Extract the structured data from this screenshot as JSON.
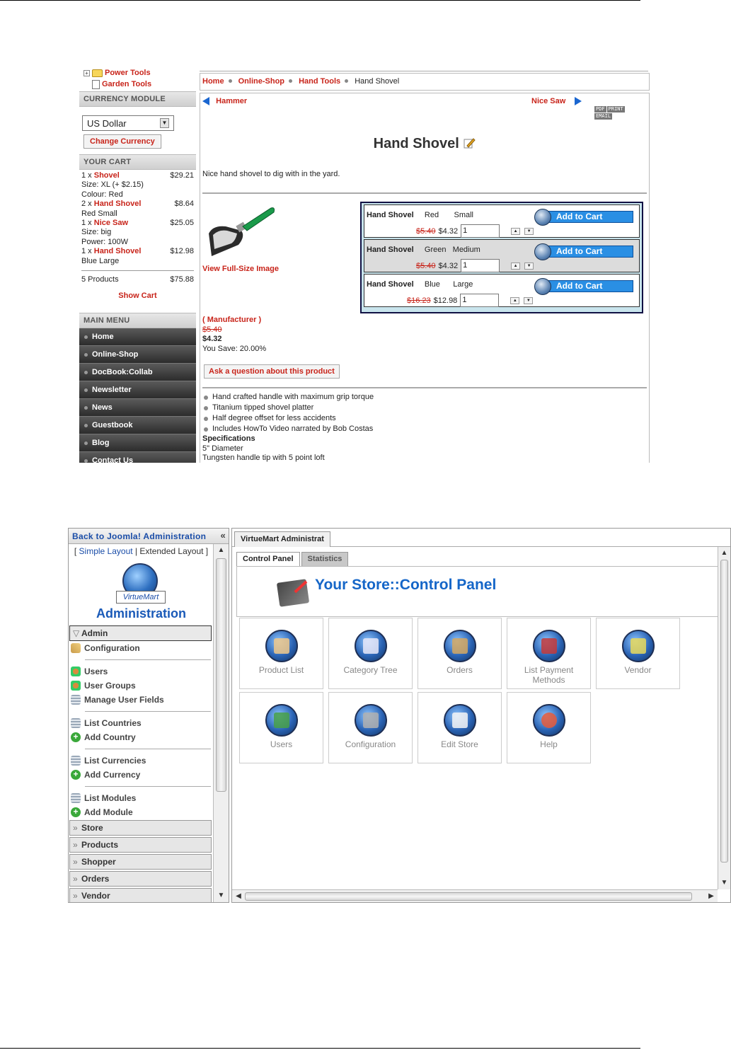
{
  "store": {
    "tree": [
      {
        "label": "Power Tools",
        "icon": "folder-icon"
      },
      {
        "label": "Garden Tools",
        "icon": "document-icon"
      }
    ],
    "currency_module": {
      "heading": "CURRENCY MODULE",
      "selected": "US Dollar",
      "button": "Change Currency"
    },
    "cart": {
      "heading": "YOUR CART",
      "lines": [
        {
          "qty": "1 x",
          "name": "Shovel",
          "price": "$29.21",
          "details": [
            "Size: XL (+ $2.15)",
            "Colour: Red"
          ]
        },
        {
          "qty": "2 x",
          "name": "Hand Shovel",
          "price": "$8.64",
          "details": [
            "Red Small"
          ]
        },
        {
          "qty": "1 x",
          "name": "Nice Saw",
          "price": "$25.05",
          "details": [
            "Size: big",
            "Power: 100W"
          ]
        },
        {
          "qty": "1 x",
          "name": "Hand Shovel",
          "price": "$12.98",
          "details": [
            "Blue Large"
          ]
        }
      ],
      "total_label": "5 Products",
      "total_value": "$75.88",
      "show_cart": "Show Cart"
    },
    "main_menu": {
      "heading": "MAIN MENU",
      "items": [
        "Home",
        "Online-Shop",
        "DocBook:Collab",
        "Newsletter",
        "News",
        "Guestbook",
        "Blog",
        "Contact Us"
      ]
    },
    "breadcrumb": [
      "Home",
      "Online-Shop",
      "Hand Tools",
      "Hand Shovel"
    ],
    "prev_product": "Hammer",
    "next_product": "Nice Saw",
    "badges": [
      "PDF",
      "PRINT",
      "EMAIL"
    ],
    "product": {
      "title": "Hand Shovel",
      "description": "Nice hand shovel to dig with in the yard.",
      "view_full": "View Full-Size Image",
      "manufacturer": "( Manufacturer )",
      "old_price": "$5.40",
      "price": "$4.32",
      "you_save": "You Save: 20.00%",
      "ask": "Ask a question about this product",
      "bullets": [
        "Hand crafted handle with maximum grip torque",
        "Titanium tipped shovel platter",
        "Half degree offset for less accidents",
        "Includes HowTo Video narrated by Bob Costas"
      ],
      "specs_heading": "Specifications",
      "specs": [
        "5\" Diameter",
        "Tungsten handle tip with 5 point loft"
      ]
    },
    "variants": [
      {
        "name": "Hand Shovel",
        "color": "Red",
        "size": "Small",
        "old": "$5.40",
        "price": "$4.32",
        "qty": "1",
        "add": "Add to Cart"
      },
      {
        "name": "Hand Shovel",
        "color": "Green",
        "size": "Medium",
        "old": "$5.40",
        "price": "$4.32",
        "qty": "1",
        "add": "Add to Cart"
      },
      {
        "name": "Hand Shovel",
        "color": "Blue",
        "size": "Large",
        "old": "$16.23",
        "price": "$12.98",
        "qty": "1",
        "add": "Add to Cart"
      }
    ]
  },
  "admin": {
    "back_link": "Back to Joomla! Administration",
    "collapse_glyph": "«",
    "layout_simple": "Simple Layout",
    "layout_extended": "Extended Layout",
    "logo_ribbon": "VirtueMart",
    "logo_title": "Administration",
    "admin_section": "Admin",
    "menu_groups": [
      [
        {
          "label": "Configuration",
          "icon": "configuration-icon"
        }
      ],
      [
        {
          "label": "Users",
          "icon": "users-icon"
        },
        {
          "label": "User Groups",
          "icon": "users-icon"
        },
        {
          "label": "Manage User Fields",
          "icon": "list-icon"
        }
      ],
      [
        {
          "label": "List Countries",
          "icon": "list-icon"
        },
        {
          "label": "Add Country",
          "icon": "add-icon"
        }
      ],
      [
        {
          "label": "List Currencies",
          "icon": "list-icon"
        },
        {
          "label": "Add Currency",
          "icon": "add-icon"
        }
      ],
      [
        {
          "label": "List Modules",
          "icon": "list-icon"
        },
        {
          "label": "Add Module",
          "icon": "add-icon"
        }
      ]
    ],
    "collapsed_sections": [
      "Store",
      "Products",
      "Shopper",
      "Orders",
      "Vendor"
    ],
    "main_tab": "VirtueMart Administrat",
    "sub_tabs": [
      "Control Panel",
      "Statistics"
    ],
    "panel_title": "Your Store::Control Panel",
    "tiles": [
      {
        "label": "Product List",
        "icon": "product-list-icon",
        "color": "#f0c88a"
      },
      {
        "label": "Category Tree",
        "icon": "category-tree-icon",
        "color": "#e8e8f8"
      },
      {
        "label": "Orders",
        "icon": "orders-icon",
        "color": "#d4a760"
      },
      {
        "label": "List Payment Methods",
        "icon": "payment-methods-icon",
        "color": "#c43a3a"
      },
      {
        "label": "Vendor",
        "icon": "vendor-icon",
        "color": "#e8d85a"
      },
      {
        "label": "Users",
        "icon": "users-icon",
        "color": "#48a048"
      },
      {
        "label": "Configuration",
        "icon": "configuration-icon",
        "color": "#b0b0b0"
      },
      {
        "label": "Edit Store",
        "icon": "edit-store-icon",
        "color": "#f4f4f4"
      },
      {
        "label": "Help",
        "icon": "help-icon",
        "color": "#e85a3a"
      }
    ]
  }
}
